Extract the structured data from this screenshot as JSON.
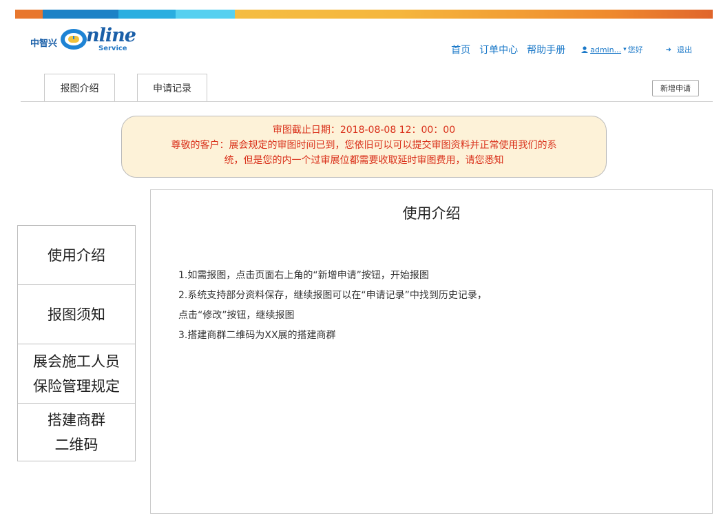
{
  "brand": {
    "name_cn": "中智兴",
    "name_en": "nline",
    "sub": "Service"
  },
  "nav": {
    "links": [
      "首页",
      "订单中心",
      "帮助手册"
    ],
    "user_name": "admin...",
    "greeting": "您好",
    "logout": "退出"
  },
  "tabs": [
    "报图介绍",
    "申请记录"
  ],
  "new_request_button": "新增申请",
  "notice": {
    "line1": "审图截止日期：2018-08-08 12：00：00",
    "line2": "尊敬的客户：展会规定的审图时间已到，您依旧可以可以提交审图资料并正常使用我们的系",
    "line3": "统，但是您的内一个过审展位都需要收取延时审图费用，请您悉知",
    "color": "#d9301a",
    "background": "#fdf2d8"
  },
  "sidebar": {
    "items": [
      {
        "lines": [
          "使用介绍"
        ]
      },
      {
        "lines": [
          "报图须知"
        ]
      },
      {
        "lines": [
          "展会施工人员",
          "保险管理规定"
        ]
      },
      {
        "lines": [
          "搭建商群",
          "二维码"
        ]
      }
    ]
  },
  "content": {
    "title": "使用介绍",
    "paragraphs": [
      "1.如需报图，点击页面右上角的“新增申请”按钮，开始报图",
      "2.系统支持部分资料保存，继续报图可以在“申请记录”中找到历史记录，",
      "点击“修改”按钮，继续报图",
      "3.搭建商群二维码为XX展的搭建商群"
    ]
  },
  "colors": {
    "link": "#1a78c8",
    "brand_blue": "#1a5fa8"
  }
}
